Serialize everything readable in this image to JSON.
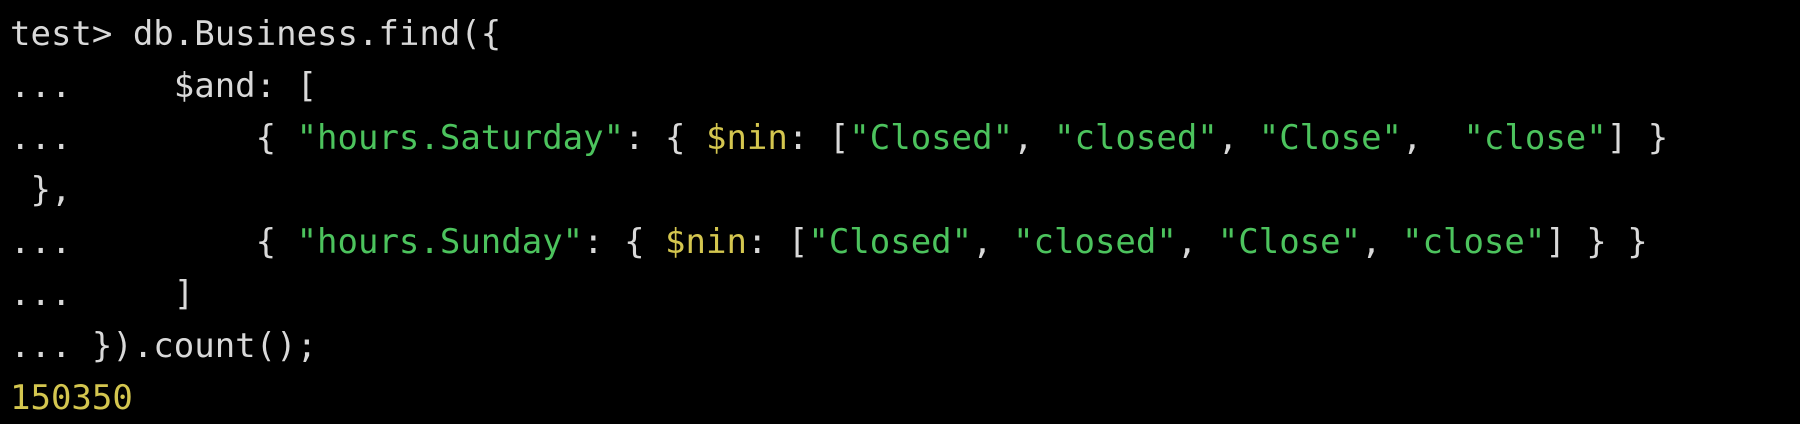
{
  "terminal": {
    "lines": [
      [
        {
          "text": "test> db.Business.find({",
          "style": "default"
        }
      ],
      [
        {
          "text": "...     $and: [",
          "style": "default"
        }
      ],
      [
        {
          "text": "...         { ",
          "style": "default"
        },
        {
          "text": "\"hours.Saturday\"",
          "style": "string"
        },
        {
          "text": ": { ",
          "style": "default"
        },
        {
          "text": "$nin",
          "style": "op"
        },
        {
          "text": ": [",
          "style": "default"
        },
        {
          "text": "\"Closed\"",
          "style": "string"
        },
        {
          "text": ", ",
          "style": "default"
        },
        {
          "text": "\"closed\"",
          "style": "string"
        },
        {
          "text": ", ",
          "style": "default"
        },
        {
          "text": "\"Close\"",
          "style": "string"
        },
        {
          "text": ",  ",
          "style": "default"
        },
        {
          "text": "\"close\"",
          "style": "string"
        },
        {
          "text": "] }",
          "style": "default"
        }
      ],
      [
        {
          "text": " },",
          "style": "default"
        }
      ],
      [
        {
          "text": "...         { ",
          "style": "default"
        },
        {
          "text": "\"hours.Sunday\"",
          "style": "string"
        },
        {
          "text": ": { ",
          "style": "default"
        },
        {
          "text": "$nin",
          "style": "op"
        },
        {
          "text": ": [",
          "style": "default"
        },
        {
          "text": "\"Closed\"",
          "style": "string"
        },
        {
          "text": ", ",
          "style": "default"
        },
        {
          "text": "\"closed\"",
          "style": "string"
        },
        {
          "text": ", ",
          "style": "default"
        },
        {
          "text": "\"Close\"",
          "style": "string"
        },
        {
          "text": ", ",
          "style": "default"
        },
        {
          "text": "\"close\"",
          "style": "string"
        },
        {
          "text": "] } }",
          "style": "default"
        }
      ],
      [
        {
          "text": "...     ]",
          "style": "default"
        }
      ],
      [
        {
          "text": "... }).count();",
          "style": "default"
        }
      ],
      [
        {
          "text": "150350",
          "style": "result"
        }
      ]
    ]
  },
  "colors": {
    "background": "#000000",
    "default_text": "#d9d9d9",
    "string": "#4cc35d",
    "operator": "#d4c64f",
    "result": "#d4c64f"
  }
}
